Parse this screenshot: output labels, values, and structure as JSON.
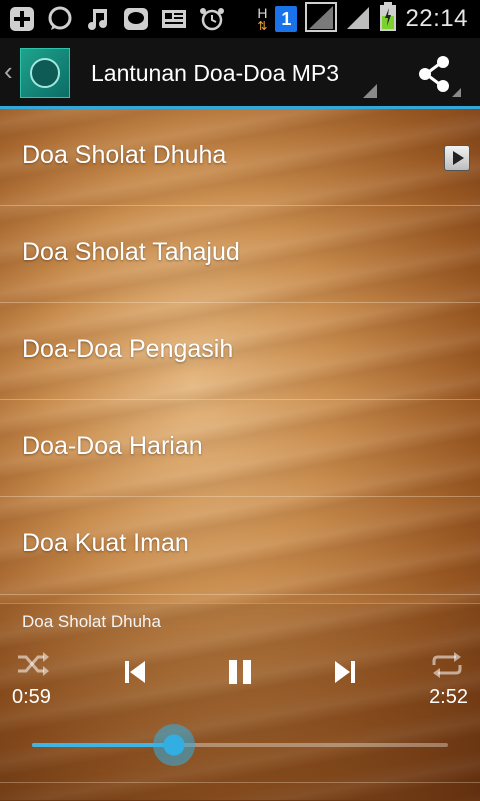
{
  "status_bar": {
    "time": "22:14",
    "network_label": "H",
    "notification_badge": "1"
  },
  "action_bar": {
    "title": "Lantunan Doa-Doa MP3"
  },
  "songs": [
    {
      "title": "Doa Sholat Dhuha"
    },
    {
      "title": "Doa Sholat Tahajud"
    },
    {
      "title": "Doa-Doa Pengasih"
    },
    {
      "title": "Doa-Doa Harian"
    },
    {
      "title": "Doa Kuat Iman"
    }
  ],
  "player": {
    "now_playing": "Doa Sholat Dhuha",
    "current_time": "0:59",
    "total_time": "2:52",
    "progress": 0.342,
    "accent_color": "#33aee3"
  }
}
